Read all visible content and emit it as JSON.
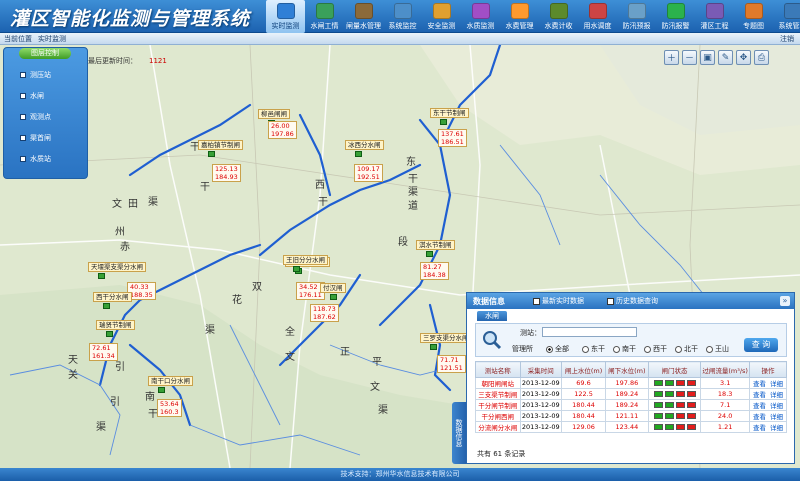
{
  "app": {
    "title": "灌区智能化监测与管理系统"
  },
  "nav": [
    {
      "label": "实时监测",
      "color": "#2f7fd6",
      "active": true
    },
    {
      "label": "水闸工情",
      "color": "#3aa05a"
    },
    {
      "label": "闸量水管理",
      "color": "#8b6a3a"
    },
    {
      "label": "系统监控",
      "color": "#4d8fc9"
    },
    {
      "label": "安全监测",
      "color": "#e0a030"
    },
    {
      "label": "水质监测",
      "color": "#a14ec6"
    },
    {
      "label": "水费管理",
      "color": "#ff9a2e"
    },
    {
      "label": "水费计收",
      "color": "#5c8a2c"
    },
    {
      "label": "用水调度",
      "color": "#cc4444"
    },
    {
      "label": "防汛预报",
      "color": "#6aa0c8"
    },
    {
      "label": "防汛报警",
      "color": "#2bb24c"
    },
    {
      "label": "灌区工程",
      "color": "#7a5bb5"
    },
    {
      "label": "专题图",
      "color": "#e07a2b"
    },
    {
      "label": "系统管理",
      "color": "#3b7ab8"
    }
  ],
  "subbar": {
    "location_label": "当前位置",
    "location_value": "实时监测",
    "logout": "注销"
  },
  "layers": {
    "button": "图层控制",
    "items": [
      "测压站",
      "水闸",
      "观测点",
      "渠首闸",
      "水质站"
    ]
  },
  "update": {
    "label": "最后更新时间：",
    "value": "1121"
  },
  "map_tools": [
    "zoom-in",
    "zoom-out",
    "full-extent",
    "measure",
    "pan",
    "print"
  ],
  "stations": [
    {
      "name": "柳邑闸闸",
      "vals": [
        "26.00",
        "197.86"
      ]
    },
    {
      "name": "嘉柏镇节制闸",
      "vals": [
        "125.13",
        "184.93"
      ]
    },
    {
      "name": "冰西分水闸",
      "vals": [
        "109.17",
        "192.51"
      ]
    },
    {
      "name": "东干节制闸",
      "vals": [
        "137.61",
        "186.51"
      ]
    },
    {
      "name": "淇水节制闸",
      "vals": [
        "81.27",
        "184.38"
      ]
    },
    {
      "name": "天堰渠支渠分水闸",
      "vals": [
        "40.33",
        "188.35"
      ]
    },
    {
      "name": "西干分水闸",
      "vals": [
        "72.61",
        "161.34"
      ]
    },
    {
      "name": "瑞贤节制闸",
      "vals": []
    },
    {
      "name": "兵马渠分水闸",
      "vals": []
    },
    {
      "name": "王旧分分水闸",
      "vals": [
        "34.52",
        "176.11"
      ]
    },
    {
      "name": "付汉闸",
      "vals": [
        "118.73",
        "187.62"
      ]
    },
    {
      "name": "三罗支渠分水闸",
      "vals": [
        "71.71",
        "121.51"
      ]
    },
    {
      "name": "南干口分水闸",
      "vals": [
        "53.64",
        "160.3"
      ]
    }
  ],
  "info": {
    "title": "数据信息",
    "check_realtime": "最新实时数据",
    "check_history": "历史数据查询",
    "tab": "水闸",
    "station_label": "测站：",
    "station_value": "",
    "region_label": "管理所",
    "regions": [
      "全部",
      "东干",
      "南干",
      "西干",
      "北干",
      "王山"
    ],
    "query_button": "查 询",
    "columns": [
      "测站名称",
      "采集时间",
      "闸上水位(m)",
      "闸下水位(m)",
      "闸门状态",
      "过闸流量(m³/s)",
      "操作"
    ],
    "rows": [
      {
        "name": "朝阳闸闸站",
        "time": "2013-12-09",
        "up": "69.6",
        "down": "197.86",
        "gates": [
          "g",
          "g",
          "r",
          "r"
        ],
        "flow": "3.1",
        "ops": [
          "查看",
          "详细"
        ]
      },
      {
        "name": "三支渠节制闸",
        "time": "2013-12-09",
        "up": "122.5",
        "down": "189.24",
        "gates": [
          "g",
          "g",
          "r",
          "r"
        ],
        "flow": "18.3",
        "ops": [
          "查看",
          "详细"
        ]
      },
      {
        "name": "干分闸节制闸",
        "time": "2013-12-09",
        "up": "180.44",
        "down": "189.24",
        "gates": [
          "g",
          "g",
          "r",
          "r"
        ],
        "flow": "7.1",
        "ops": [
          "查看",
          "详细"
        ]
      },
      {
        "name": "干分闸西闸",
        "time": "2013-12-09",
        "up": "180.44",
        "down": "121.11",
        "gates": [
          "g",
          "g",
          "r",
          "r"
        ],
        "flow": "24.0",
        "ops": [
          "查看",
          "详细"
        ]
      },
      {
        "name": "分流闸分水闸",
        "time": "2013-12-09",
        "up": "129.06",
        "down": "123.44",
        "gates": [
          "g",
          "g",
          "r",
          "r"
        ],
        "flow": "1.21",
        "ops": [
          "查看",
          "详细"
        ]
      }
    ],
    "record_count": "共有 61 条记录",
    "side_label": "数据信息"
  },
  "footer": "技术支持：郑州华水信息技术有限公司",
  "colors": {
    "header": "#2a72c0",
    "accent_green": "#3f9c25",
    "value_red": "#dd0000"
  }
}
